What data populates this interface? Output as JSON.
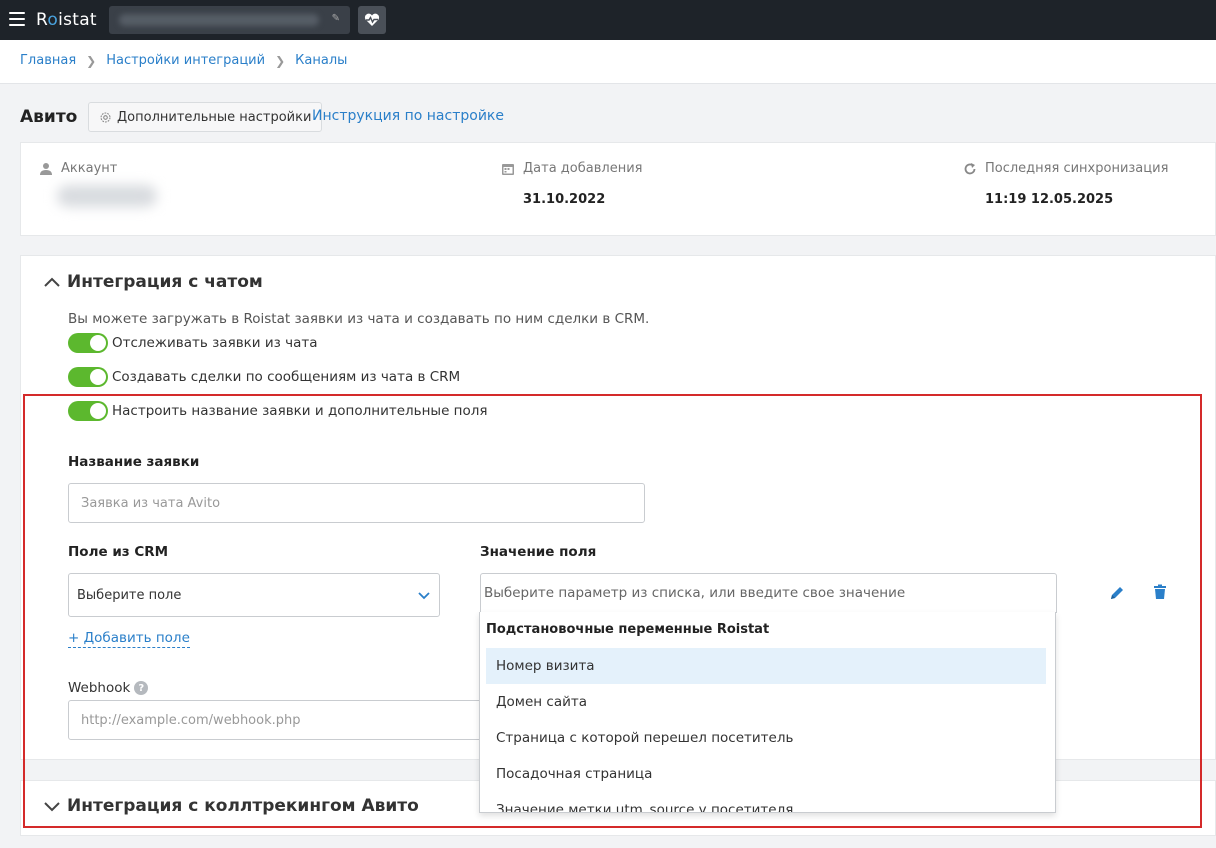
{
  "topbar": {
    "logo_prefix": "R",
    "logo_accent": "o",
    "logo_suffix": "istat",
    "icons": [
      "menu-icon",
      "pencil-icon",
      "heart-pulse-icon"
    ]
  },
  "breadcrumb": {
    "items": [
      "Главная",
      "Настройки интеграций",
      "Каналы"
    ]
  },
  "header": {
    "title": "Авито",
    "extra_settings_label": "Дополнительные настройки",
    "instruction_link": "Инструкция по настройке"
  },
  "info": {
    "account_label": "Аккаунт",
    "date_label": "Дата добавления",
    "date_value": "31.10.2022",
    "sync_label": "Последняя синхронизация",
    "sync_value": "11:19 12.05.2025"
  },
  "chat": {
    "title": "Интеграция с чатом",
    "description": "Вы можете загружать в Roistat заявки из чата и создавать по ним сделки в CRM.",
    "toggles": [
      {
        "label": "Отслеживать заявки из чата",
        "on": true
      },
      {
        "label": "Создавать сделки по сообщениям из чата в CRM",
        "on": true
      },
      {
        "label": "Настроить название заявки и дополнительные поля",
        "on": true
      }
    ],
    "lead_name_label": "Название заявки",
    "lead_name_placeholder": "Заявка из чата Avito",
    "crm_field_label": "Поле из CRM",
    "crm_field_value": "Выберите поле",
    "field_value_label": "Значение поля",
    "field_value_placeholder": "Выберите параметр из списка, или введите свое значение",
    "add_field": "+ Добавить поле",
    "webhook_label": "Webhook",
    "webhook_placeholder": "http://example.com/webhook.php"
  },
  "dropdown": {
    "group": "Подстановочные переменные Roistat",
    "items": [
      "Номер визита",
      "Домен сайта",
      "Страница с которой перешел посетитель",
      "Посадочная страница",
      "Значение метки utm_source у посетителя"
    ],
    "active_index": 0
  },
  "calltracking": {
    "title": "Интеграция с коллтрекингом Авито"
  },
  "colors": {
    "accent": "#2a7fc9",
    "toggle_on": "#5cb82e",
    "highlight": "#d42a2a"
  }
}
